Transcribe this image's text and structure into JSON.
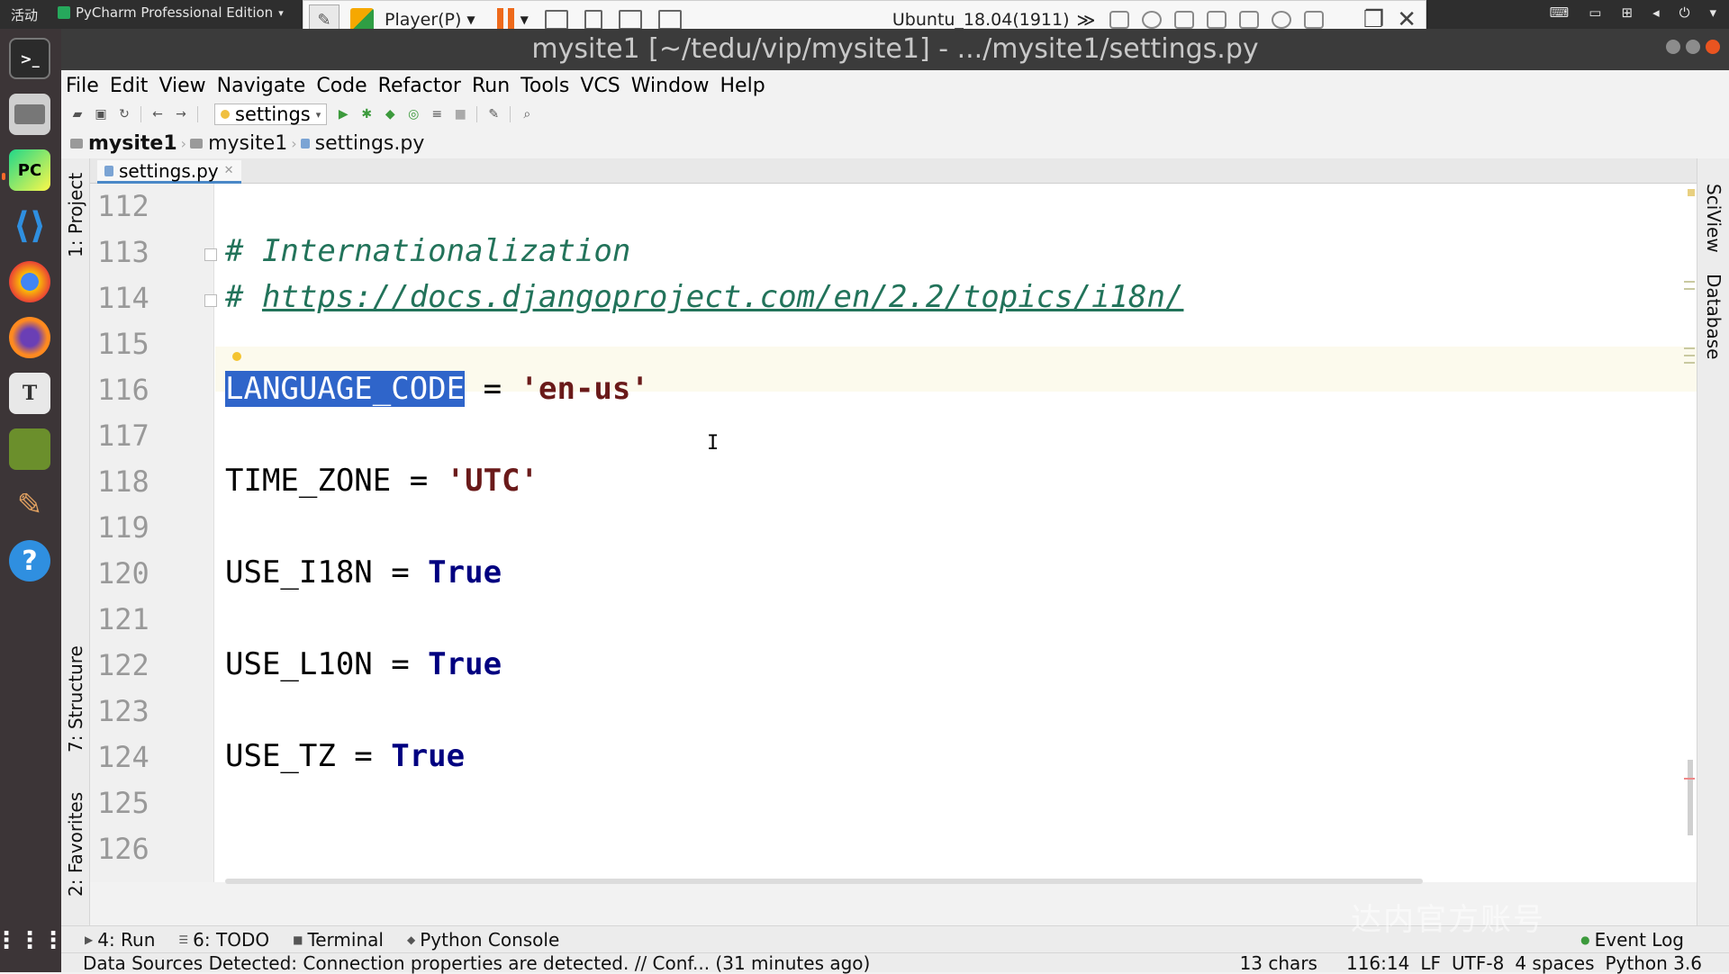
{
  "topbar": {
    "activities": "活动",
    "app_menu": "PyCharm Professional Edition"
  },
  "vmware": {
    "player_label": "Player(P)",
    "vm_name": "Ubuntu_18.04(1911)",
    "chevron": "≫"
  },
  "window": {
    "title": "mysite1 [~/tedu/vip/mysite1] - .../mysite1/settings.py"
  },
  "menu": [
    "File",
    "Edit",
    "View",
    "Navigate",
    "Code",
    "Refactor",
    "Run",
    "Tools",
    "VCS",
    "Window",
    "Help"
  ],
  "toolbar": {
    "run_config": "settings"
  },
  "breadcrumb": {
    "root": "mysite1",
    "folder": "mysite1",
    "file": "settings.py"
  },
  "left_tools": {
    "project": "1: Project",
    "structure": "7: Structure",
    "favorites": "2: Favorites"
  },
  "right_tools": {
    "sciview": "SciView",
    "database": "Database"
  },
  "editor": {
    "tab_label": "settings.py",
    "line_numbers": [
      "112",
      "113",
      "114",
      "115",
      "116",
      "117",
      "118",
      "119",
      "120",
      "121",
      "122",
      "123",
      "124",
      "125",
      "126"
    ],
    "lines": {
      "l113": "# Internationalization",
      "l114_hash": "# ",
      "l114_url": "https://docs.djangoproject.com/en/2.2/topics/i18n/",
      "l116_sel": "LANGUAGE_CODE",
      "l116_op": " = ",
      "l116_val": "'en-us'",
      "l118_name": "TIME_ZONE = ",
      "l118_val": "'UTC'",
      "l120_name": "USE_I18N = ",
      "l120_val": "True",
      "l122_name": "USE_L10N = ",
      "l122_val": "True",
      "l124_name": "USE_TZ = ",
      "l124_val": "True"
    }
  },
  "bottom_tabs": {
    "run": "4: Run",
    "todo": "6: TODO",
    "terminal": "Terminal",
    "python_console": "Python Console",
    "event_log": "Event Log"
  },
  "status": {
    "message": "Data Sources Detected: Connection properties are detected. // Conf... (31 minutes ago)",
    "chars": "13 chars",
    "position": "116:14",
    "line_sep": "LF",
    "encoding": "UTF-8",
    "indent": "4 spaces",
    "interpreter": "Python 3.6"
  },
  "watermark": "达内官方账号",
  "colors": {
    "selection": "#2f65ca",
    "keyword": "#000080",
    "comment": "#22735a",
    "string": "#067d17",
    "current_line": "#fcfaed"
  }
}
